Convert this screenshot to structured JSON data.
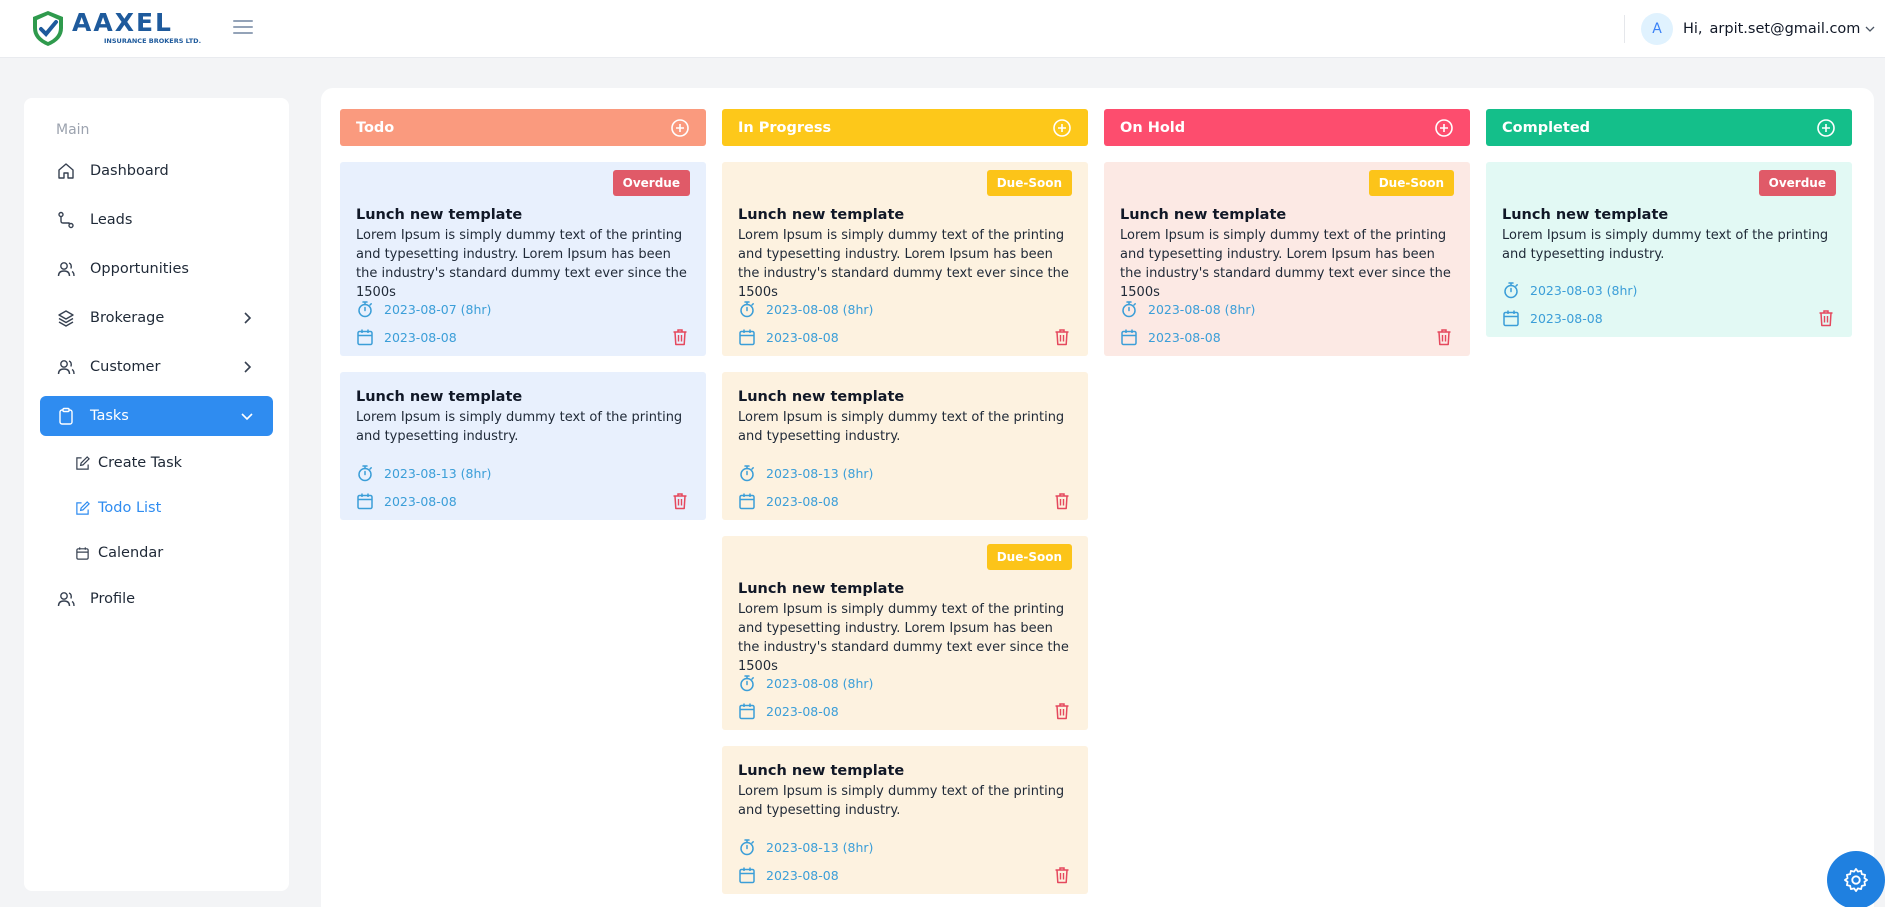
{
  "brand": {
    "name": "AAXEL",
    "tagline": "INSURANCE BROKERS LTD.",
    "color": "#1e5a9c"
  },
  "user": {
    "avatar_letter": "A",
    "greeting": "Hi,",
    "email": "arpit.set@gmail.com"
  },
  "sidebar": {
    "section": "Main",
    "items": [
      {
        "label": "Dashboard",
        "icon": "home-icon"
      },
      {
        "label": "Leads",
        "icon": "route-icon"
      },
      {
        "label": "Opportunities",
        "icon": "users-icon"
      },
      {
        "label": "Brokerage",
        "icon": "layers-icon"
      },
      {
        "label": "Customer",
        "icon": "users-icon"
      },
      {
        "label": "Tasks",
        "icon": "clipboard-icon"
      },
      {
        "label": "Profile",
        "icon": "users-icon"
      }
    ],
    "subitems": [
      {
        "label": "Create Task",
        "icon": "edit-icon"
      },
      {
        "label": "Todo List",
        "icon": "edit-icon"
      },
      {
        "label": "Calendar",
        "icon": "calendar-icon"
      }
    ]
  },
  "columns": [
    {
      "title": "Todo",
      "color": "#fa9a7e",
      "card_bg": "#e8f0fd",
      "cards": [
        {
          "badge": "Overdue",
          "title": "Lunch new template",
          "desc": "Lorem Ipsum is simply dummy text of the printing and typesetting industry. Lorem Ipsum has been the industry's standard dummy text ever since the 1500s",
          "time": "2023-08-07 (8hr)",
          "date": "2023-08-08"
        },
        {
          "badge": "",
          "title": "Lunch new template",
          "desc": "Lorem Ipsum is simply dummy text of the printing and typesetting industry.",
          "time": "2023-08-13 (8hr)",
          "date": "2023-08-08"
        }
      ]
    },
    {
      "title": "In Progress",
      "color": "#fdc81a",
      "card_bg": "#fdf2e0",
      "cards": [
        {
          "badge": "Due-Soon",
          "title": "Lunch new template",
          "desc": "Lorem Ipsum is simply dummy text of the printing and typesetting industry. Lorem Ipsum has been the industry's standard dummy text ever since the 1500s",
          "time": "2023-08-08 (8hr)",
          "date": "2023-08-08"
        },
        {
          "badge": "",
          "title": "Lunch new template",
          "desc": "Lorem Ipsum is simply dummy text of the printing and typesetting industry.",
          "time": "2023-08-13 (8hr)",
          "date": "2023-08-08"
        },
        {
          "badge": "Due-Soon",
          "title": "Lunch new template",
          "desc": "Lorem Ipsum is simply dummy text of the printing and typesetting industry. Lorem Ipsum has been the industry's standard dummy text ever since the 1500s",
          "time": "2023-08-08 (8hr)",
          "date": "2023-08-08"
        },
        {
          "badge": "",
          "title": "Lunch new template",
          "desc": "Lorem Ipsum is simply dummy text of the printing and typesetting industry.",
          "time": "2023-08-13 (8hr)",
          "date": "2023-08-08"
        }
      ]
    },
    {
      "title": "On Hold",
      "color": "#fd4d6e",
      "card_bg": "#fce9e4",
      "cards": [
        {
          "badge": "Due-Soon",
          "title": "Lunch new template",
          "desc": "Lorem Ipsum is simply dummy text of the printing and typesetting industry. Lorem Ipsum has been the industry's standard dummy text ever since the 1500s",
          "time": "2023-08-08 (8hr)",
          "date": "2023-08-08"
        }
      ]
    },
    {
      "title": "Completed",
      "color": "#14bf8a",
      "card_bg": "#e2f9f4",
      "cards": [
        {
          "badge": "Overdue",
          "title": "Lunch new template",
          "desc": "Lorem Ipsum is simply dummy text of the printing and typesetting industry.",
          "time": "2023-08-03 (8hr)",
          "date": "2023-08-08"
        }
      ]
    }
  ],
  "colors": {
    "accent": "#2f8cf0",
    "overdue": "#e05a68",
    "due_soon": "#fcc419",
    "meta": "#3b9ed8",
    "trash": "#e5485d"
  }
}
